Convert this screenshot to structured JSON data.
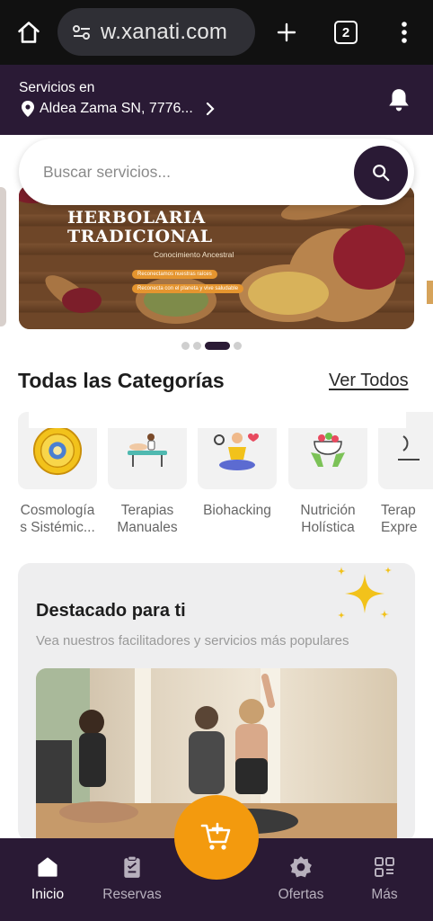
{
  "browser": {
    "url": "w.xanati.com",
    "tab_count": "2"
  },
  "header": {
    "services_label": "Servicios en",
    "location": "Aldea Zama SN, 7776..."
  },
  "search": {
    "placeholder": "Buscar servicios..."
  },
  "banner": {
    "title_line1": "HERBOLARIA",
    "title_line2": "TRADICIONAL",
    "subtitle": "Conocimiento Ancestral",
    "chip1": "Reconectamos nuestras raíces",
    "chip2": "Reconecta con el planeta y vive saludable",
    "slides_total": 4,
    "active_slide": 3
  },
  "categories": {
    "title": "Todas las Categorías",
    "see_all": "Ver Todos",
    "items": [
      {
        "line1": "Cosmología",
        "line2": "s Sistémic..."
      },
      {
        "line1": "Terapias",
        "line2": "Manuales"
      },
      {
        "line1": "Biohacking",
        "line2": ""
      },
      {
        "line1": "Nutrición",
        "line2": "Holística"
      },
      {
        "line1": "Terap",
        "line2": "Expre"
      }
    ]
  },
  "featured": {
    "title": "Destacado para ti",
    "subtitle": "Vea nuestros facilitadores y servicios más populares"
  },
  "nav": {
    "items": [
      {
        "label": "Inicio",
        "icon": "home-icon"
      },
      {
        "label": "Reservas",
        "icon": "clipboard-icon"
      },
      {
        "label": "Ofertas",
        "icon": "badge-icon"
      },
      {
        "label": "Más",
        "icon": "grid-icon"
      }
    ],
    "fab_icon": "cart-add-icon"
  },
  "colors": {
    "brand_dark": "#2a1a35",
    "accent_orange": "#f39a0e"
  }
}
